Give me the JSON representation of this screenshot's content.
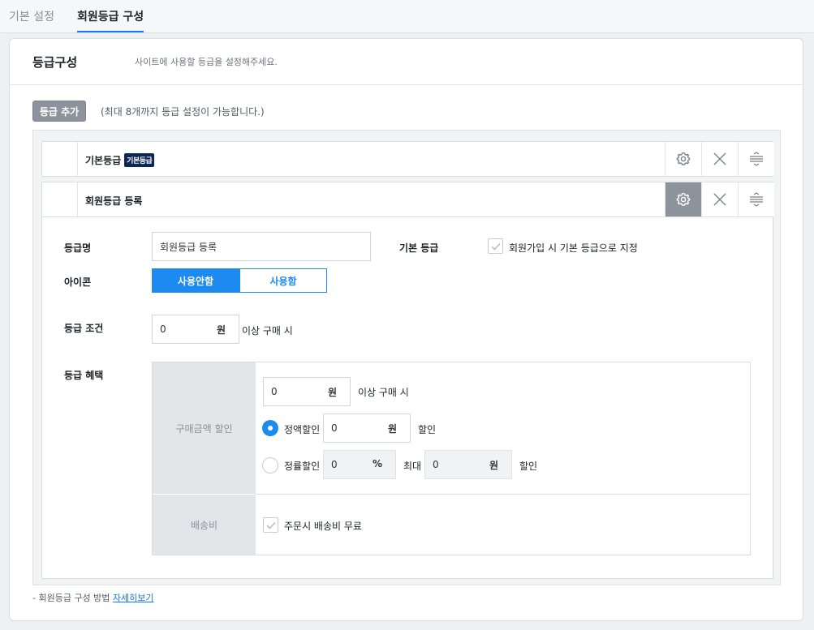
{
  "tabs": [
    {
      "label": "기본 설정"
    },
    {
      "label": "회원등급 구성"
    }
  ],
  "header": {
    "title": "등급구성",
    "description": "사이트에 사용할 등급을 설정해주세요."
  },
  "toolbar": {
    "add_label": "등급 추가",
    "note": "(최대 8개까지 등급 설정이 가능합니다.)"
  },
  "grades": [
    {
      "name": "기본등급",
      "badge": "기본등급"
    },
    {
      "name": "회원등급 등록"
    }
  ],
  "form": {
    "name_label": "등급명",
    "name_value": "회원등급 등록",
    "default_label": "기본 등급",
    "default_checkbox_label": "회원가입 시 기본 등급으로 지정",
    "icon_label": "아이콘",
    "icon_options": [
      "사용안함",
      "사용함"
    ],
    "icon_selected": "사용안함",
    "condition_label": "등급 조건",
    "condition_value": "0",
    "condition_unit": "원",
    "condition_suffix": "이상 구매 시",
    "benefit_label": "등급 혜택",
    "benefit": {
      "purchase_discount_label": "구매금액 할인",
      "min_amount": "0",
      "min_unit": "원",
      "min_suffix": "이상 구매 시",
      "fixed_label": "정액할인",
      "fixed_value": "0",
      "fixed_unit": "원",
      "fixed_suffix": "할인",
      "rate_label": "정률할인",
      "rate_value": "0",
      "rate_unit": "%",
      "max_label": "최대",
      "max_value": "0",
      "max_unit": "원",
      "max_suffix": "할인",
      "selected": "정액할인",
      "shipping_label": "배송비",
      "shipping_checkbox_label": "주문시 배송비 무료"
    }
  },
  "footnote": {
    "prefix": "-  회원등급 구성 방법",
    "link": "자세히보기"
  },
  "colors": {
    "accent": "#1d8aef",
    "badge_bg": "#0c2657",
    "active_button": "#8d939d"
  }
}
